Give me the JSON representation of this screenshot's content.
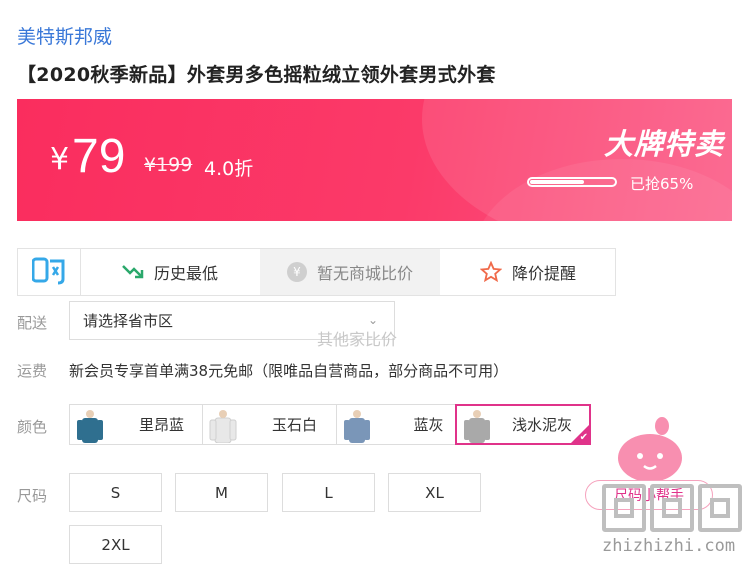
{
  "store": {
    "brand": "美特斯邦威"
  },
  "product": {
    "title": "【2020秋季新品】外套男多色摇粒绒立领外套男式外套"
  },
  "price": {
    "currency": "¥",
    "current": "79",
    "original": "¥199",
    "discount": "4.0折",
    "promo_title": "大牌特卖",
    "sold_label": "已抢65%",
    "sold_fraction": 0.65
  },
  "tools": {
    "buy_icon_text": "购",
    "history": "历史最低",
    "compare": "暂无商城比价",
    "compare_icon": "¥",
    "price_alert": "降价提醒"
  },
  "shipping": {
    "label": "配送",
    "select_value": "请选择省市区",
    "ghost_text": "其他家比价"
  },
  "fee": {
    "label": "运费",
    "text": "新会员专享首单满38元免邮（限唯品自营商品，部分商品不可用）"
  },
  "colors": {
    "label": "颜色",
    "options": [
      {
        "name": "里昂蓝",
        "swatch": "#2f6f8f"
      },
      {
        "name": "玉石白",
        "swatch": "#ececec"
      },
      {
        "name": "蓝灰",
        "swatch": "#7a96b8"
      },
      {
        "name": "浅水泥灰",
        "swatch": "#a9a9a9"
      }
    ],
    "selected_index": 3
  },
  "sizes": {
    "label": "尺码",
    "options": [
      "S",
      "M",
      "L",
      "XL",
      "2XL"
    ]
  },
  "helper": {
    "label": "尺码小帮手"
  },
  "watermark": {
    "text": "zhizhizhi.com"
  },
  "theme": {
    "accent": "#fa2d5e",
    "selected_border": "#e0338a",
    "brand_blue": "#3a78d8"
  }
}
